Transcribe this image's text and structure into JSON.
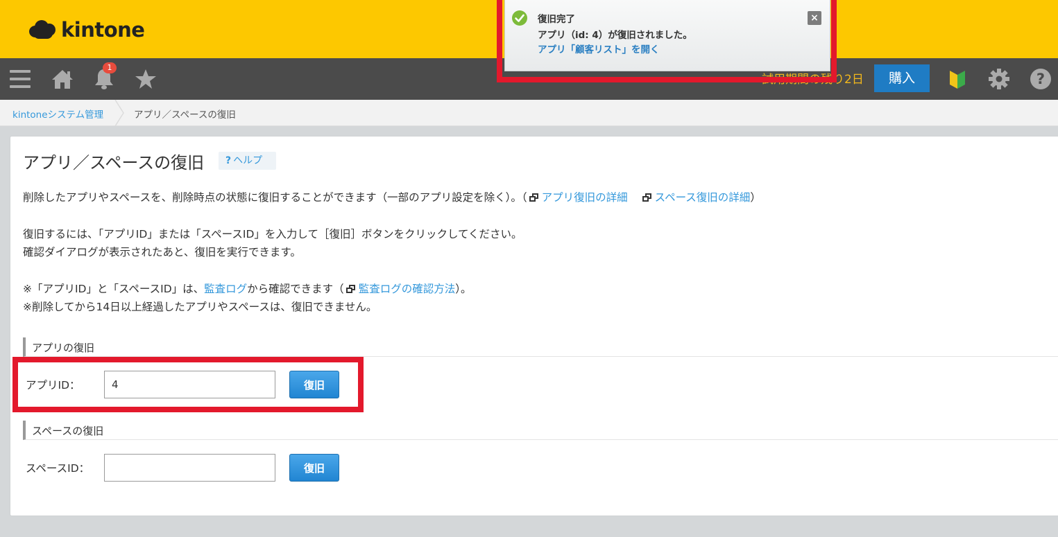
{
  "header": {
    "logo_text": "kintone",
    "brand_color": "#fdc800"
  },
  "toolbar": {
    "icons": [
      "menu-icon",
      "home-icon",
      "bell-icon",
      "star-icon",
      "beginner-mark-icon",
      "gear-icon",
      "help-icon"
    ],
    "notification_count": "1",
    "trial_text": "試用期間の残り2日",
    "buy_label": "購入"
  },
  "breadcrumb": {
    "items": [
      "kintoneシステム管理",
      "アプリ／スペースの復旧"
    ]
  },
  "page": {
    "title": "アプリ／スペースの復旧",
    "help_icon": "?",
    "help_label": "ヘルプ",
    "desc_1_pre": "削除したアプリやスペースを、削除時点の状態に復旧することができます（一部のアプリ設定を除く）。（",
    "desc_1_link1": "アプリ復旧の詳細",
    "desc_1_link2": "スペース復旧の詳細",
    "desc_1_post": "）",
    "desc_2": "復旧するには、「アプリID」または「スペースID」を入力して［復旧］ボタンをクリックしてください。",
    "desc_3": "確認ダイアログが表示されたあと、復旧を実行できます。",
    "note_1_pre": "※「アプリID」と「スペースID」は、",
    "note_1_link1": "監査ログ",
    "note_1_mid": "から確認できます（",
    "note_1_link2": "監査ログの確認方法",
    "note_1_post": "）。",
    "note_2": "※削除してから14日以上経過したアプリやスペースは、復旧できません。"
  },
  "app_restore": {
    "section_title": "アプリの復旧",
    "label": "アプリID：",
    "value": "4",
    "button": "復旧"
  },
  "space_restore": {
    "section_title": "スペースの復旧",
    "label": "スペースID：",
    "value": "",
    "button": "復旧"
  },
  "notification": {
    "title": "復旧完了",
    "message": "アプリ（id: 4）が復旧されました。",
    "link": "アプリ「顧客リスト」を開く",
    "close": "×"
  },
  "colors": {
    "highlight": "#e3192c",
    "link": "#3498db",
    "button": "#2185d2"
  }
}
